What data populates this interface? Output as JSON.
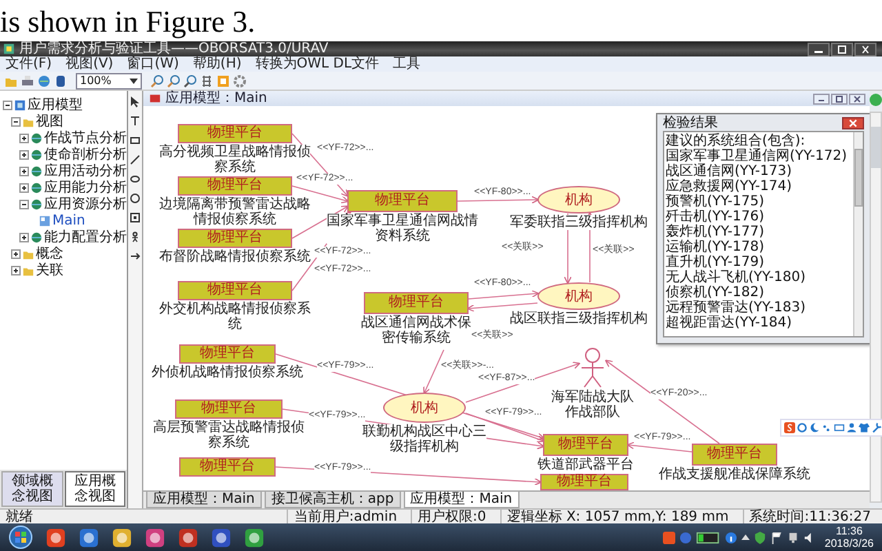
{
  "paper_text": "is shown in Figure 3.",
  "window": {
    "title": "用户需求分析与验证工具——OBORSAT3.0/URAV"
  },
  "menu": [
    "文件(F)",
    "视图(V)",
    "窗口(W)",
    "帮助(H)",
    "转换为OWL DL文件",
    "工具"
  ],
  "toolbar": {
    "zoom": "100%"
  },
  "tree": [
    {
      "label": "应用模型",
      "expanded": true,
      "children": [
        {
          "label": "视图",
          "expanded": true,
          "children": [
            {
              "label": "作战节点分析",
              "expanded": false
            },
            {
              "label": "使命剖析分析",
              "expanded": false
            },
            {
              "label": "应用活动分析",
              "expanded": false
            },
            {
              "label": "应用能力分析",
              "expanded": false
            },
            {
              "label": "应用资源分析",
              "expanded": true,
              "children": [
                {
                  "label": "Main"
                }
              ]
            },
            {
              "label": "能力配置分析",
              "expanded": false
            }
          ]
        },
        {
          "label": "概念",
          "expanded": false
        },
        {
          "label": "关联",
          "expanded": false
        }
      ]
    }
  ],
  "panel_tabs": [
    {
      "label": "领域概念视图",
      "selected": false
    },
    {
      "label": "应用概念视图",
      "selected": true
    }
  ],
  "document": {
    "title": "应用模型：Main"
  },
  "diagram": {
    "nodes": [
      {
        "kind": "platform",
        "text": "物理平台",
        "label": "高分视频卫星战略情报侦察系统"
      },
      {
        "kind": "platform",
        "text": "物理平台",
        "label": "边境隔离带预警雷达战略情报侦察系统"
      },
      {
        "kind": "platform",
        "text": "物理平台",
        "label": "布督阶战略情报侦察系统"
      },
      {
        "kind": "platform",
        "text": "物理平台",
        "label": "外交机构战略情报侦察系统"
      },
      {
        "kind": "platform",
        "text": "物理平台",
        "label": "外侦机战略情报侦察系统"
      },
      {
        "kind": "platform",
        "text": "物理平台",
        "label": "高层预警雷达战略情报侦察系统"
      },
      {
        "kind": "platform",
        "text": "物理平台"
      },
      {
        "kind": "platform",
        "text": "物理平台",
        "label": "国家军事卫星通信网战情资料系统"
      },
      {
        "kind": "platform",
        "text": "物理平台",
        "label": "战区通信网战术保密传输系统"
      },
      {
        "kind": "agency",
        "text": "机构",
        "label": "军委联指三级指挥机构"
      },
      {
        "kind": "agency",
        "text": "机构",
        "label": "战区联指三级指挥机构"
      },
      {
        "kind": "agency",
        "text": "机构",
        "label": "联勤机构战区中心三级指挥机构"
      },
      {
        "kind": "actor",
        "label": "海军陆战大队作战部队"
      },
      {
        "kind": "platform",
        "text": "物理平台",
        "label": "铁道部武器平台"
      },
      {
        "kind": "platform",
        "text": "物理平台"
      },
      {
        "kind": "platform",
        "text": "物理平台",
        "label": "作战支援舰准战保障系统"
      }
    ],
    "edges": [
      {
        "label": "<<YF-72>>..."
      },
      {
        "label": "<<YF-72>>..."
      },
      {
        "label": "<<YF-72>>..."
      },
      {
        "label": "<<YF-72>>..."
      },
      {
        "label": "<<YF-80>>..."
      },
      {
        "label": "<<关联>>"
      },
      {
        "label": "<<关联>>"
      },
      {
        "label": "<<YF-80>>..."
      },
      {
        "label": "<<关联>>"
      },
      {
        "label": "<<关联>>-..."
      },
      {
        "label": "<<YF-79>>..."
      },
      {
        "label": "<<YF-79>>..."
      },
      {
        "label": "<<YF-79>>..."
      },
      {
        "label": "<<YF-87>>..."
      },
      {
        "label": "<<YF-79>>..."
      },
      {
        "label": "<<YF-20>>..."
      },
      {
        "label": "<<YF-79>>..."
      }
    ]
  },
  "dialog": {
    "title": "检验结果",
    "items": [
      "建议的系统组合(包含):",
      "国家军事卫星通信网(YY-172)",
      "战区通信网(YY-173)",
      "应急救援网(YY-174)",
      "预警机(YY-175)",
      "歼击机(YY-176)",
      "轰炸机(YY-177)",
      "运输机(YY-178)",
      "直升机(YY-179)",
      "无人战斗飞机(YY-180)",
      "侦察机(YY-182)",
      "远程预警雷达(YY-183)",
      "超视距雷达(YY-184)"
    ]
  },
  "doc_tabs": [
    {
      "label": "应用模型：Main",
      "selected": false
    },
    {
      "label": "接卫候高主机：app",
      "selected": false
    },
    {
      "label": "应用模型：Main",
      "selected": true
    }
  ],
  "status_bar": [
    "就绪",
    "当前用户:admin",
    "用户权限:0",
    "逻辑坐标 X: 1057 mm,Y: 189 mm",
    "系统时间:11:36:27"
  ],
  "taskbar": {
    "time": "11:36",
    "date": "2018/3/26"
  }
}
